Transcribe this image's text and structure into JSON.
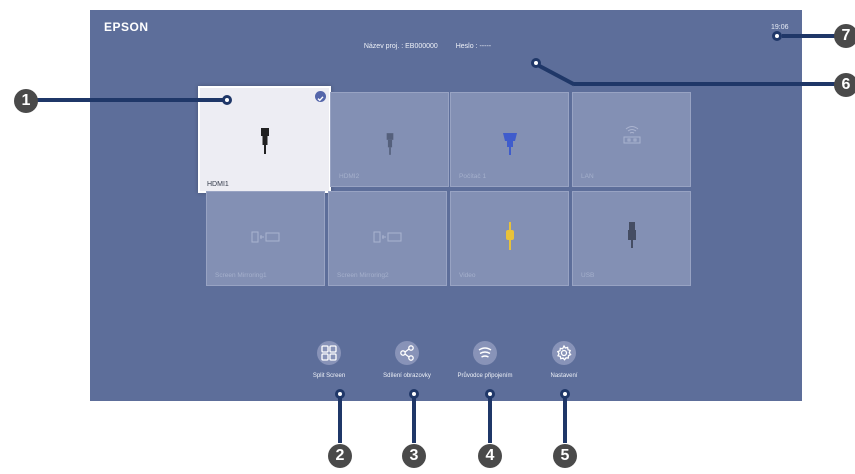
{
  "header": {
    "logo": "EPSON",
    "time": "19:06",
    "projector_name_label": "Název proj. :",
    "projector_name": "EB000000",
    "password_label": "Heslo :",
    "password": "-----"
  },
  "sources": [
    {
      "label": "HDMI1",
      "icon": "hdmi-plug-icon",
      "selected": true
    },
    {
      "label": "HDMI2",
      "icon": "hdmi-plug-icon",
      "selected": false
    },
    {
      "label": "Počítač 1",
      "icon": "vga-plug-icon",
      "selected": false
    },
    {
      "label": "LAN",
      "icon": "lan-icon",
      "selected": false
    },
    {
      "label": "Screen Mirroring1",
      "icon": "screen-mirroring-icon",
      "selected": false
    },
    {
      "label": "Screen Mirroring2",
      "icon": "screen-mirroring-icon",
      "selected": false
    },
    {
      "label": "Video",
      "icon": "video-plug-icon",
      "selected": false
    },
    {
      "label": "USB",
      "icon": "usb-plug-icon",
      "selected": false
    }
  ],
  "bottom_buttons": [
    {
      "label": "Split Screen",
      "icon": "split-screen-icon"
    },
    {
      "label": "Sdílení obrazovky",
      "icon": "share-icon"
    },
    {
      "label": "Průvodce připojením",
      "icon": "connection-guide-icon"
    },
    {
      "label": "Nastavení",
      "icon": "gear-icon"
    }
  ],
  "callouts": [
    "1",
    "2",
    "3",
    "4",
    "5",
    "6",
    "7"
  ],
  "colors": {
    "screen_bg": "#5d6e9a",
    "tile_bg": "#8390b4",
    "callout_line": "#1f3768",
    "accent": "#5566aa"
  }
}
